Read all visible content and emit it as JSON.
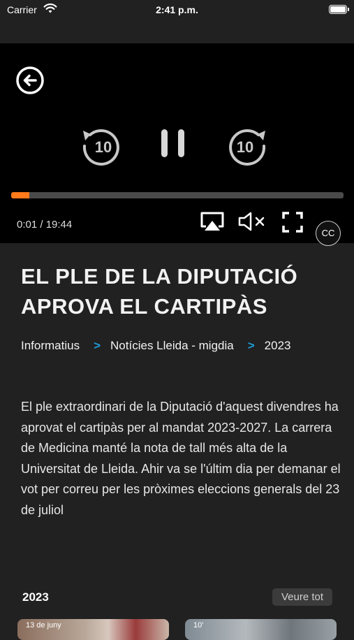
{
  "status_bar": {
    "carrier": "Carrier",
    "time": "2:41 p.m."
  },
  "player": {
    "back_icon": "arrow-left-circle-icon",
    "rewind_icon": "rewind-10-icon",
    "rewind_label": "10",
    "pause_icon": "pause-icon",
    "forward_icon": "forward-10-icon",
    "forward_label": "10",
    "progress": 0.055,
    "time_display": "0:01 / 19:44",
    "airplay_icon": "airplay-icon",
    "mute_icon": "speaker-muted-icon",
    "fullscreen_icon": "fullscreen-icon",
    "cc_label": "CC",
    "accent_color": "#ff7a1a"
  },
  "article": {
    "title": "EL PLE DE LA DIPUTACIÓ APROVA EL CARTIPÀS",
    "breadcrumb": [
      {
        "label": "Informatius"
      },
      {
        "label": "Notícies Lleida - migdia"
      },
      {
        "label": "2023"
      }
    ],
    "breadcrumb_separator": ">",
    "separator_color": "#1d9dd8",
    "description": "El ple extraordinari de la Diputació d'aquest divendres ha aprovat el cartipàs per al mandat 2023-2027. La carrera de Medicina manté la nota de tall més alta de la Universitat de Lleida. Ahir va se l'últim dia per demanar el vot per correu per les pròximes eleccions generals del 23 de juliol"
  },
  "related": {
    "title": "2023",
    "see_all": "Veure tot",
    "items": [
      {
        "label": "13 de juny"
      },
      {
        "label": "10'"
      }
    ]
  }
}
